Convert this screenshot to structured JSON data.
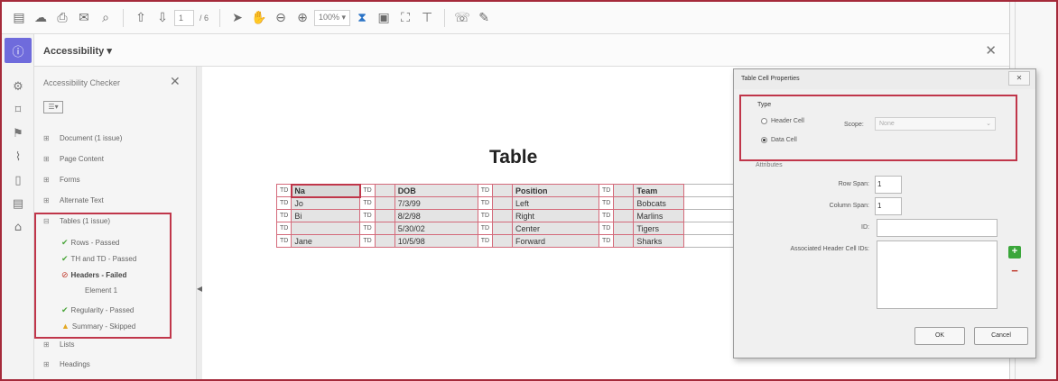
{
  "toolbar": {
    "page_current": "1",
    "page_total": "/ 6",
    "zoom": "100% ▾"
  },
  "panel": {
    "title": "Accessibility ▾",
    "close": "✕"
  },
  "checker": {
    "title": "Accessibility Checker",
    "close": "✕",
    "options": "☰▾",
    "items": [
      {
        "label": "Document (1 issue)"
      },
      {
        "label": "Page Content"
      },
      {
        "label": "Forms"
      },
      {
        "label": "Alternate Text"
      },
      {
        "label": "Tables (1 issue)"
      },
      {
        "label": "Rows - Passed"
      },
      {
        "label": "TH and TD - Passed"
      },
      {
        "label": "Headers - Failed"
      },
      {
        "label": "Element 1"
      },
      {
        "label": "Regularity - Passed"
      },
      {
        "label": "Summary - Skipped"
      },
      {
        "label": "Lists"
      },
      {
        "label": "Headings"
      }
    ]
  },
  "document": {
    "title": "Table",
    "tag": "TD",
    "rows": [
      {
        "c1": "Na",
        "c2": "",
        "c3": "DOB",
        "c4": "",
        "c5": "Position",
        "c6": "",
        "c7": "Team"
      },
      {
        "c1": "Jo",
        "c2": "",
        "c3": "7/3/99",
        "c4": "",
        "c5": "Left",
        "c6": "",
        "c7": "Bobcats"
      },
      {
        "c1": "Bi",
        "c2": "",
        "c3": "8/2/98",
        "c4": "",
        "c5": "Right",
        "c6": "",
        "c7": "Marlins"
      },
      {
        "c1": "",
        "c2": "",
        "c3": "5/30/02",
        "c4": "",
        "c5": "Center",
        "c6": "",
        "c7": "Tigers"
      },
      {
        "c1": "Jane",
        "c2": "",
        "c3": "10/5/98",
        "c4": "",
        "c5": "Forward",
        "c6": "",
        "c7": "Sharks"
      }
    ]
  },
  "dialog": {
    "title": "Table Cell Properties",
    "close": "✕",
    "type_label": "Type",
    "header_cell": "Header Cell",
    "data_cell": "Data Cell",
    "selected_type": "Data Cell",
    "scope_label": "Scope:",
    "scope_value": "None",
    "attributes_label": "Attributes",
    "row_span_label": "Row Span:",
    "row_span_value": "1",
    "col_span_label": "Column Span:",
    "col_span_value": "1",
    "id_label": "ID:",
    "id_value": "",
    "assoc_label": "Associated Header Cell IDs:",
    "ok": "OK",
    "cancel": "Cancel"
  }
}
